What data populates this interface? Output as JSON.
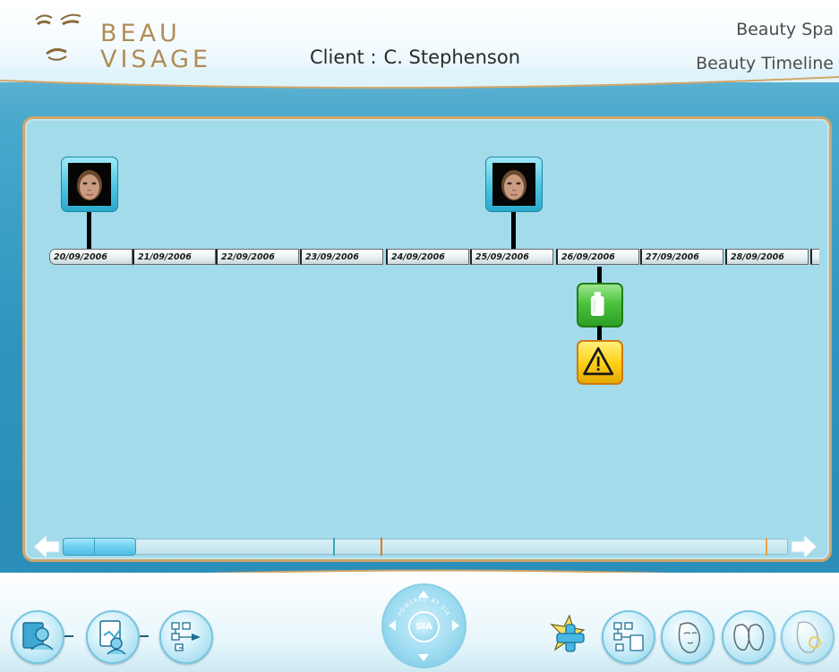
{
  "header": {
    "logo": {
      "line1": "BEAU",
      "line2": "VISAGE"
    },
    "client_label": "Client :",
    "client_name": "C. Stephenson",
    "app_name": "Beauty Spa",
    "page_name": "Beauty Timeline"
  },
  "timeline": {
    "dates": [
      "20/09/2006",
      "21/09/2006",
      "22/09/2006",
      "23/09/2006",
      "24/09/2006",
      "25/09/2006",
      "26/09/2006",
      "27/09/2006",
      "28/09/2006",
      ""
    ],
    "photo_events": [
      "20/09/2006",
      "25/09/2006"
    ],
    "product_events": [
      "26/09/2006"
    ],
    "warning_events": [
      "26/09/2006"
    ]
  },
  "scrollbar": {
    "marker_colors": [
      "#3aa6b5",
      "#e07a12",
      "#e8a24a"
    ]
  },
  "footer": {
    "dial_label": "SIA",
    "dial_ring_text": "POWERED BY SIA"
  },
  "colors": {
    "accent_gold": "#b08c58",
    "panel_bg": "#a4dbea",
    "product_green": "#3cb833",
    "warning_yellow": "#ffd21a"
  }
}
